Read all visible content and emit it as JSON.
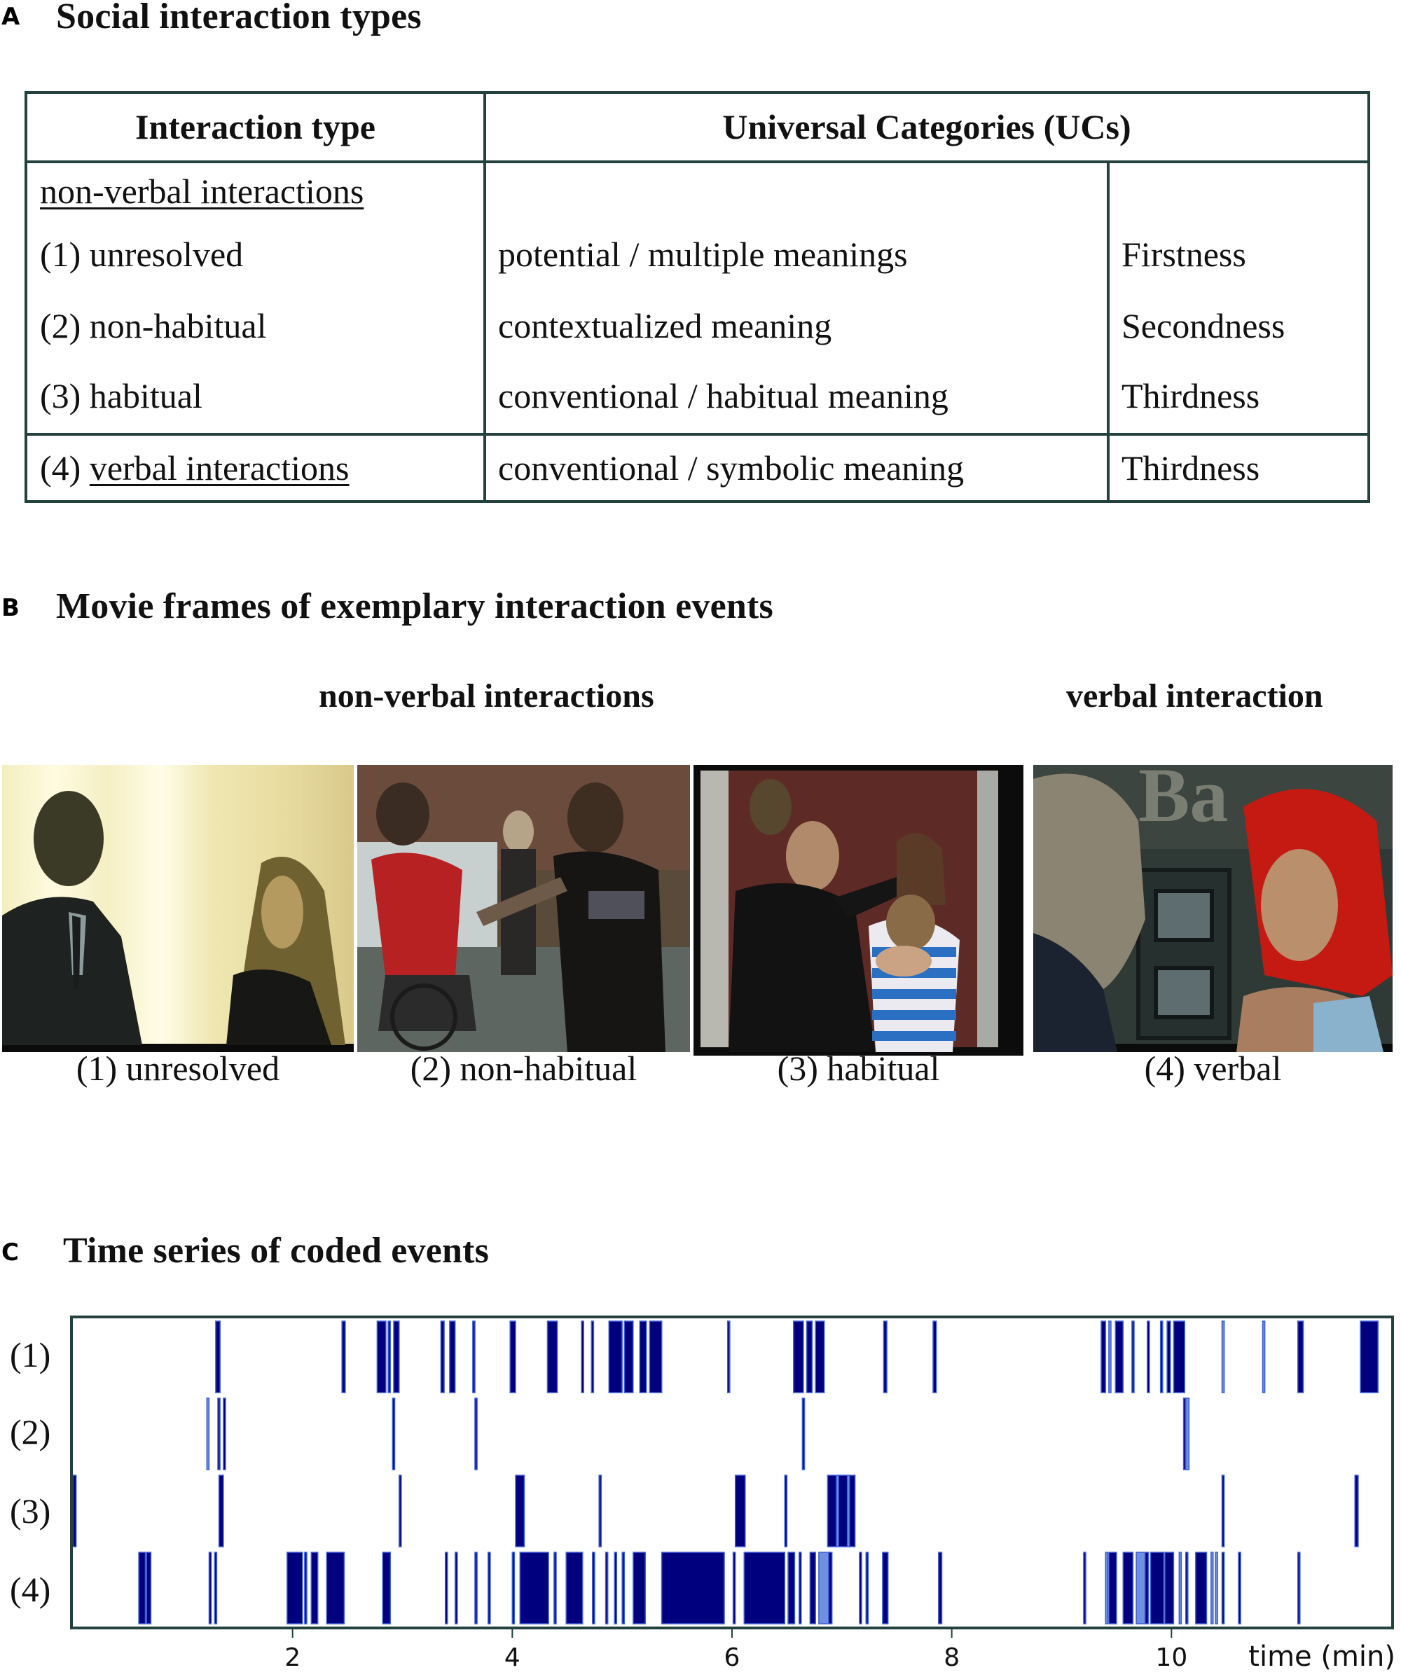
{
  "panel_a": {
    "letter": "A",
    "title": "Social interaction types",
    "table": {
      "headers": [
        "Interaction type",
        "Universal Categories (UCs)"
      ],
      "group_label": "non-verbal interactions",
      "rows": [
        {
          "type": "(1) unresolved",
          "meaning": "potential / multiple meanings",
          "category": "Firstness"
        },
        {
          "type": "(2) non-habitual",
          "meaning": "contextualized meaning",
          "category": "Secondness"
        },
        {
          "type": "(3) habitual",
          "meaning": "conventional / habitual  meaning",
          "category": "Thirdness"
        },
        {
          "type_prefix": "(4) ",
          "type_underlined": "verbal interactions",
          "meaning": "conventional / symbolic meaning",
          "category": "Thirdness"
        }
      ]
    }
  },
  "panel_b": {
    "letter": "B",
    "title": "Movie frames of exemplary interaction events",
    "group_nonverbal": "non-verbal interactions",
    "group_verbal": "verbal interaction",
    "frames": [
      {
        "caption": "(1) unresolved",
        "scene": "man in suit facing blonde woman, bright curtains"
      },
      {
        "caption": "(2) non-habitual",
        "scene": "man in red shirt on bicycle pushed by bearded man"
      },
      {
        "caption": "(3) habitual",
        "scene": "man greeting woman holding child in striped shirt"
      },
      {
        "caption": "(4) verbal",
        "scene": "older man and red-haired woman in front of bank"
      }
    ],
    "sign_text": "Ba"
  },
  "panel_c": {
    "letter": "C",
    "title": "Time series of coded events"
  },
  "chart_data": {
    "type": "event-raster",
    "title": "Time series of coded events",
    "xlabel": "time (min)",
    "ylabel": "",
    "xlim": [
      0,
      12
    ],
    "xticks": [
      2,
      4,
      6,
      8,
      10
    ],
    "grid": false,
    "colors": {
      "event": "#00007f",
      "event_light": "#6f8fe0",
      "edge": "#3b5fd6",
      "frame": "#23413f"
    },
    "rows": [
      {
        "label": "(1)",
        "events": [
          [
            1.3,
            1.34
          ],
          [
            2.45,
            2.48
          ],
          [
            2.77,
            2.85
          ],
          [
            2.87,
            2.89
          ],
          [
            2.92,
            2.97
          ],
          [
            3.35,
            3.38
          ],
          [
            3.43,
            3.48
          ],
          [
            3.64,
            3.66
          ],
          [
            3.98,
            4.03
          ],
          [
            4.32,
            4.41
          ],
          [
            4.63,
            4.65
          ],
          [
            4.72,
            4.74
          ],
          [
            4.88,
            5.0
          ],
          [
            5.02,
            5.1
          ],
          [
            5.16,
            5.22
          ],
          [
            5.25,
            5.36
          ],
          [
            5.96,
            5.98
          ],
          [
            6.56,
            6.65
          ],
          [
            6.68,
            6.73
          ],
          [
            6.76,
            6.84
          ],
          [
            7.38,
            7.41
          ],
          [
            7.83,
            7.86
          ],
          [
            9.36,
            9.4
          ],
          [
            9.49,
            9.56
          ],
          [
            9.64,
            9.66
          ],
          [
            9.78,
            9.8
          ],
          [
            9.9,
            9.92
          ],
          [
            9.96,
            9.99
          ],
          [
            10.02,
            10.12
          ],
          [
            11.15,
            11.2
          ],
          [
            11.72,
            11.88
          ]
        ],
        "light_events": [
          [
            9.43,
            9.45
          ],
          [
            10.46,
            10.48
          ],
          [
            10.83,
            10.85
          ]
        ]
      },
      {
        "label": "(2)",
        "events": [
          [
            1.32,
            1.34
          ],
          [
            1.37,
            1.39
          ],
          [
            2.91,
            2.93
          ],
          [
            3.66,
            3.68
          ],
          [
            6.64,
            6.66
          ],
          [
            10.11,
            10.13
          ]
        ],
        "light_events": [
          [
            1.22,
            1.24
          ],
          [
            10.13,
            10.16
          ]
        ]
      },
      {
        "label": "(3)",
        "events": [
          [
            0.0,
            0.03
          ],
          [
            1.33,
            1.37
          ],
          [
            2.97,
            2.99
          ],
          [
            4.03,
            4.11
          ],
          [
            4.79,
            4.81
          ],
          [
            6.03,
            6.12
          ],
          [
            6.48,
            6.5
          ],
          [
            6.87,
            6.95
          ],
          [
            6.97,
            7.05
          ],
          [
            7.07,
            7.12
          ],
          [
            10.46,
            10.48
          ],
          [
            11.67,
            11.7
          ]
        ],
        "light_events": [
          [
            6.95,
            6.97
          ],
          [
            7.05,
            7.07
          ]
        ]
      },
      {
        "label": "(4)",
        "events": [
          [
            0.6,
            0.66
          ],
          [
            0.67,
            0.71
          ],
          [
            1.24,
            1.26
          ],
          [
            1.29,
            1.31
          ],
          [
            1.95,
            2.09
          ],
          [
            2.11,
            2.13
          ],
          [
            2.17,
            2.23
          ],
          [
            2.31,
            2.47
          ],
          [
            2.82,
            2.89
          ],
          [
            3.39,
            3.41
          ],
          [
            3.48,
            3.5
          ],
          [
            3.66,
            3.68
          ],
          [
            3.78,
            3.8
          ],
          [
            4.0,
            4.02
          ],
          [
            4.07,
            4.33
          ],
          [
            4.38,
            4.4
          ],
          [
            4.49,
            4.64
          ],
          [
            4.73,
            4.75
          ],
          [
            4.85,
            4.87
          ],
          [
            4.93,
            4.95
          ],
          [
            5.0,
            5.02
          ],
          [
            5.1,
            5.21
          ],
          [
            5.36,
            5.93
          ],
          [
            6.01,
            6.03
          ],
          [
            6.11,
            6.48
          ],
          [
            6.51,
            6.57
          ],
          [
            6.61,
            6.63
          ],
          [
            6.71,
            6.76
          ],
          [
            6.88,
            6.91
          ],
          [
            7.16,
            7.18
          ],
          [
            7.22,
            7.24
          ],
          [
            7.37,
            7.42
          ],
          [
            7.88,
            7.91
          ],
          [
            9.2,
            9.22
          ],
          [
            9.43,
            9.5
          ],
          [
            9.56,
            9.65
          ],
          [
            9.76,
            9.79
          ],
          [
            9.81,
            9.93
          ],
          [
            9.94,
            10.02
          ],
          [
            10.13,
            10.15
          ],
          [
            10.22,
            10.32
          ],
          [
            10.46,
            10.48
          ],
          [
            10.61,
            10.63
          ],
          [
            11.15,
            11.17
          ]
        ],
        "light_events": [
          [
            6.79,
            6.88
          ],
          [
            9.4,
            9.41
          ],
          [
            9.68,
            9.76
          ],
          [
            10.07,
            10.09
          ],
          [
            10.36,
            10.37
          ],
          [
            10.4,
            10.41
          ]
        ]
      }
    ]
  }
}
